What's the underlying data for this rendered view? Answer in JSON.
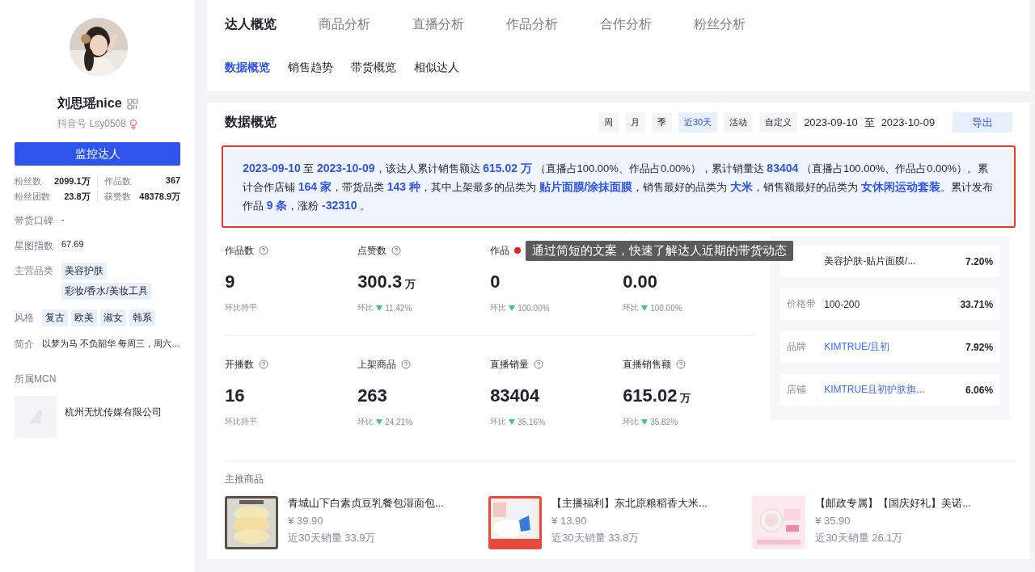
{
  "profile": {
    "name": "刘思瑶nice",
    "account": "抖音号 Lsy0508",
    "female": true,
    "monitor_button": "监控达人",
    "stats": [
      {
        "label": "粉丝数",
        "value": "2099.1万"
      },
      {
        "label": "作品数",
        "value": "367"
      },
      {
        "label": "粉丝团数",
        "value": "23.8万"
      },
      {
        "label": "获赞数",
        "value": "48378.9万"
      }
    ],
    "fields": [
      {
        "label": "带货口碑",
        "kind": "text",
        "value": "-"
      },
      {
        "label": "星图指数",
        "kind": "text",
        "value": "67.69"
      },
      {
        "label": "主营品类",
        "kind": "tags",
        "tags": [
          "美容护肤",
          "彩妆/香水/美妆工具"
        ]
      },
      {
        "label": "风格",
        "kind": "tags",
        "tags": [
          "复古",
          "欧美",
          "淑女",
          "韩系"
        ]
      },
      {
        "label": "简介",
        "kind": "text",
        "value": "以梦为马 不负韶华 每周三，周六…"
      }
    ],
    "mcn_title": "所属MCN",
    "mcn_name": "杭州无忧传媒有限公司"
  },
  "tabs": [
    {
      "label": "达人概览",
      "selected": true
    },
    {
      "label": "商品分析",
      "selected": false
    },
    {
      "label": "直播分析",
      "selected": false
    },
    {
      "label": "作品分析",
      "selected": false
    },
    {
      "label": "合作分析",
      "selected": false
    },
    {
      "label": "粉丝分析",
      "selected": false
    }
  ],
  "subtabs": [
    {
      "label": "数据概览",
      "selected": true
    },
    {
      "label": "销售趋势",
      "selected": false
    },
    {
      "label": "带货概览",
      "selected": false
    },
    {
      "label": "相似达人",
      "selected": false
    }
  ],
  "overview": {
    "title": "数据概览",
    "periods": [
      {
        "label": "周",
        "selected": false
      },
      {
        "label": "月",
        "selected": false
      },
      {
        "label": "季",
        "selected": false
      },
      {
        "label": "近30天",
        "selected": true
      },
      {
        "label": "活动",
        "selected": false
      },
      {
        "label": "自定义",
        "selected": false
      }
    ],
    "date_start": "2023-09-10",
    "date_sep": "至",
    "date_end": "2023-10-09",
    "export_button": "导出",
    "summary": "**2023-09-10** 至 **2023-10-09**，该达人累计销售额达 **615.02 万** （直播占100.00%、作品占0.00%），累计销量达 **83404** （直播占100.00%、作品占0.00%）。累计合作店铺 **164 家**，带货品类 **143 种**，其中上架最多的品类为 **贴片面膜/涂抹面膜**，销售最好的品类为 **大米**，销售额最好的品类为 **女休闲运动套装**。累计发布作品 **9 条**，涨粉 **-32310** 。",
    "metrics": [
      {
        "label": "作品数",
        "value": "9",
        "kind": "flat",
        "change": "环比持平"
      },
      {
        "label": "点赞数",
        "value": "300.3",
        "unit": "万",
        "kind": "change",
        "prefix": "环比",
        "change": "11.42%",
        "falling": true
      },
      {
        "label": "作品",
        "value": "0",
        "kind": "change",
        "prefix": "环比",
        "change": "100.00%",
        "falling": true
      },
      {
        "value": "0.00",
        "kind": "change",
        "prefix": "环比",
        "change": "100.00%",
        "falling": true
      },
      {
        "label": "开播数",
        "value": "16",
        "kind": "flat",
        "change": "环比持平"
      },
      {
        "label": "上架商品",
        "value": "263",
        "kind": "change",
        "prefix": "环比",
        "change": "24.21%",
        "falling": true
      },
      {
        "label": "直播销量",
        "value": "83404",
        "kind": "change",
        "prefix": "环比",
        "change": "35.16%",
        "falling": true
      },
      {
        "label": "直播销售额",
        "value": "615.02",
        "unit": "万",
        "kind": "change",
        "prefix": "环比",
        "change": "35.82%",
        "falling": true
      }
    ],
    "tooltip": "通过简短的文案，快速了解达人近期的带货动态",
    "shares": [
      {
        "value": "美容护肤-贴片面膜/...",
        "percent": "7.20%",
        "link": false
      },
      {
        "label": "价格带",
        "value": "100-200",
        "percent": "33.71%",
        "link": false
      },
      {
        "label": "品牌",
        "value": "KIMTRUE/且初",
        "percent": "7.92%",
        "link": true
      },
      {
        "label": "店铺",
        "value": "KIMTRUE且初护肤旗...",
        "percent": "6.06%",
        "link": true
      }
    ],
    "products_title": "主推商品",
    "products": [
      {
        "kind": "picture",
        "name": "青城山下白素贞豆乳餐包湿面包...",
        "price": "¥ 39.90",
        "sales": "近30天销量 33.9万"
      },
      {
        "kind": "picture",
        "name": "【主播福利】东北原粮稻香大米...",
        "price": "¥ 13.90",
        "sales": "近30天销量 33.8万"
      },
      {
        "kind": "picture",
        "name": "【邮政专属】【国庆好礼】美诺...",
        "price": "¥ 35.90",
        "sales": "近30天销量 26.1万"
      }
    ]
  }
}
